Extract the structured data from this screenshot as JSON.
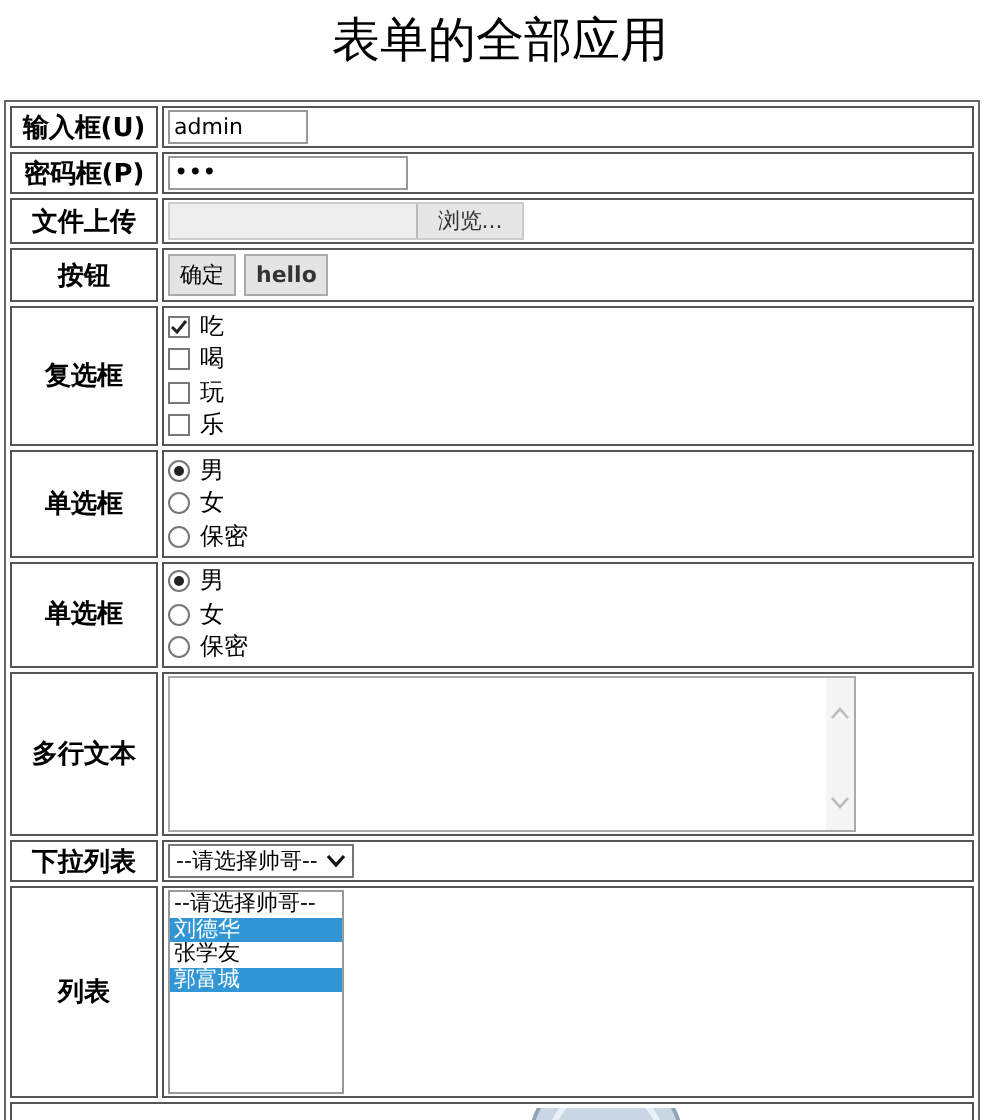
{
  "title": "表单的全部应用",
  "rows": [
    {
      "kind": "text",
      "label": "输入框(U)",
      "value": "admin"
    },
    {
      "kind": "password",
      "label": "密码框(P)",
      "value": "•••"
    },
    {
      "kind": "file",
      "label": "文件上传",
      "button": "浏览..."
    },
    {
      "kind": "buttons",
      "label": "按钮",
      "buttons": [
        "确定",
        "hello"
      ]
    },
    {
      "kind": "checkbox",
      "label": "复选框",
      "options": [
        {
          "label": "吃",
          "checked": true
        },
        {
          "label": "喝",
          "checked": false
        },
        {
          "label": "玩",
          "checked": false
        },
        {
          "label": "乐",
          "checked": false
        }
      ]
    },
    {
      "kind": "radio",
      "label": "单选框",
      "options": [
        {
          "label": "男",
          "selected": true
        },
        {
          "label": "女",
          "selected": false
        },
        {
          "label": "保密",
          "selected": false
        }
      ]
    },
    {
      "kind": "radio",
      "label": "单选框",
      "options": [
        {
          "label": "男",
          "selected": true
        },
        {
          "label": "女",
          "selected": false
        },
        {
          "label": "保密",
          "selected": false
        }
      ]
    },
    {
      "kind": "textarea",
      "label": "多行文本"
    },
    {
      "kind": "select",
      "label": "下拉列表",
      "value": "--请选择帅哥--"
    },
    {
      "kind": "listbox",
      "label": "列表",
      "options": [
        {
          "label": "--请选择帅哥--",
          "selected": false
        },
        {
          "label": "刘德华",
          "selected": true
        },
        {
          "label": "张学友",
          "selected": false
        },
        {
          "label": "郭富城",
          "selected": true
        }
      ]
    },
    {
      "kind": "image"
    }
  ]
}
